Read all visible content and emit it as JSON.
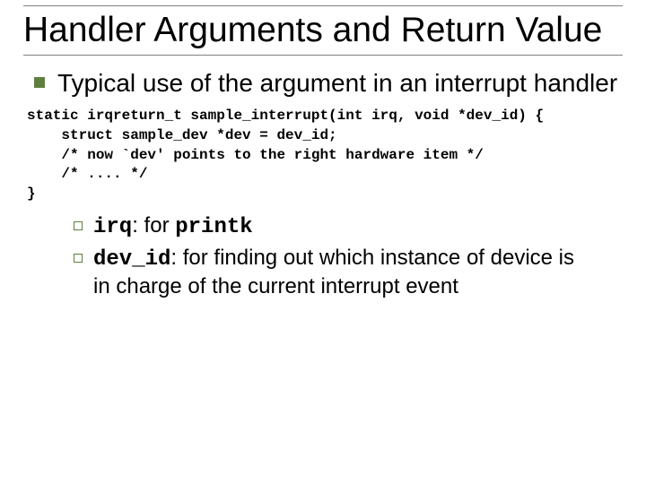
{
  "title": "Handler Arguments and Return Value",
  "point1": "Typical use of the argument in an interrupt handler",
  "code": "static irqreturn_t sample_interrupt(int irq, void *dev_id) {\n    struct sample_dev *dev = dev_id;\n    /* now `dev' points to the right hardware item */\n    /* .... */\n}",
  "sub": {
    "a_code": "irq",
    "a_mid": ": for ",
    "a_code2": "printk",
    "b_code": "dev_id",
    "b_rest": ":  for finding out which instance of device is in charge of the current interrupt event"
  }
}
